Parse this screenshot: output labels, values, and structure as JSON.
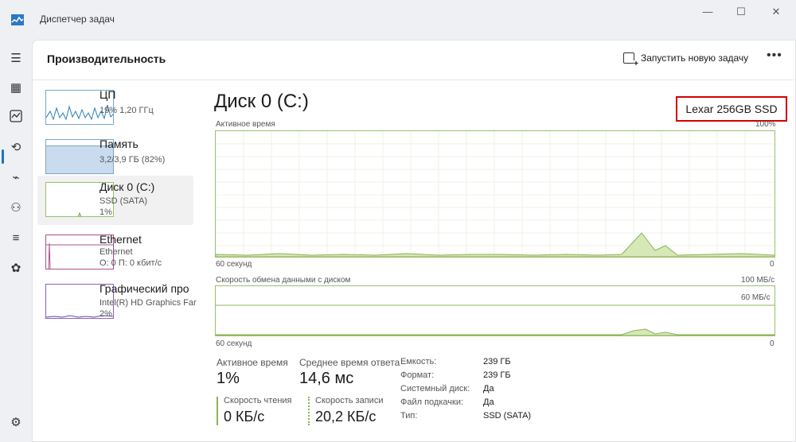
{
  "app": {
    "title": "Диспетчер задач"
  },
  "window_controls": {
    "minimize": "—",
    "maximize": "☐",
    "close": "✕"
  },
  "header": {
    "page_title": "Производительность",
    "run_task_label": "Запустить новую задачу",
    "more_label": "•••"
  },
  "rail": {
    "icons": [
      "menu-icon",
      "processes-icon",
      "performance-icon",
      "history-icon",
      "startup-icon",
      "users-icon",
      "details-icon",
      "services-icon",
      "settings-icon"
    ]
  },
  "devices": [
    {
      "name": "ЦП",
      "sub1": "19% 1,20 ГГц",
      "sub2": ""
    },
    {
      "name": "Память",
      "sub1": "3,2/3,9 ГБ (82%)",
      "sub2": ""
    },
    {
      "name": "Диск 0 (C:)",
      "sub1": "SSD (SATA)",
      "sub2": "1%"
    },
    {
      "name": "Ethernet",
      "sub1": "Ethernet",
      "sub2": "О: 0 П: 0 кбит/с"
    },
    {
      "name": "Графический про",
      "sub1": "Intel(R) HD Graphics Far",
      "sub2": "2%"
    }
  ],
  "detail": {
    "title": "Диск 0 (C:)",
    "model": "Lexar 256GB SSD",
    "graph1": {
      "label": "Активное время",
      "max": "100%",
      "time": "60 секунд",
      "min": "0"
    },
    "graph2": {
      "label": "Скорость обмена данными с диском",
      "max": "100 МБ/с",
      "mid": "60 МБ/с",
      "time": "60 секунд",
      "min": "0"
    },
    "stats": {
      "active_label": "Активное время",
      "active_value": "1%",
      "resp_label": "Среднее время ответа",
      "resp_value": "14,6 мс",
      "read_label": "Скорость чтения",
      "read_value": "0 КБ/с",
      "write_label": "Скорость записи",
      "write_value": "20,2 КБ/с"
    },
    "props": [
      {
        "k": "Емкость:",
        "v": "239 ГБ"
      },
      {
        "k": "Формат:",
        "v": "239 ГБ"
      },
      {
        "k": "Системный диск:",
        "v": "Да"
      },
      {
        "k": "Файл подкачки:",
        "v": "Да"
      },
      {
        "k": "Тип:",
        "v": "SSD (SATA)"
      }
    ]
  },
  "colors": {
    "disk_green": "#9bbf6a",
    "accent_blue": "#1a73c8",
    "model_border": "#d40000"
  }
}
